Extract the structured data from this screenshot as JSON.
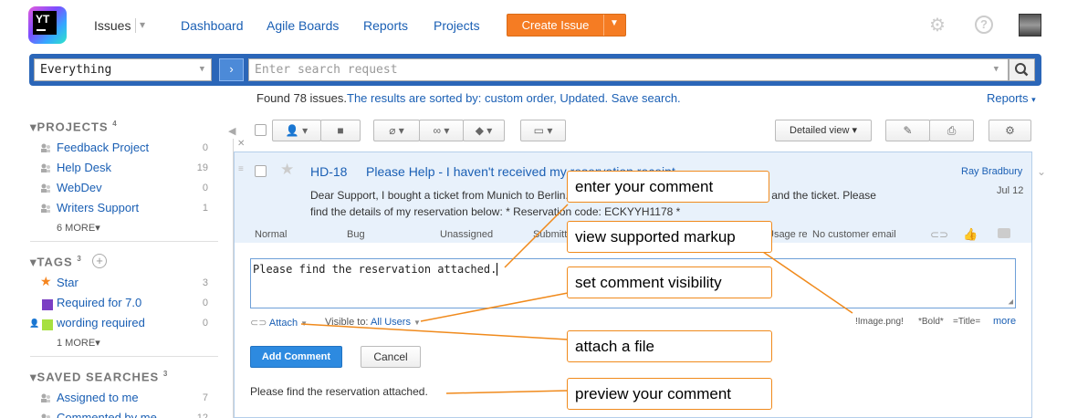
{
  "nav": {
    "logo_text": "YT",
    "issues": "Issues",
    "links": [
      "Dashboard",
      "Agile Boards",
      "Reports",
      "Projects"
    ],
    "create_issue": "Create Issue"
  },
  "search": {
    "context": "Everything",
    "placeholder": "Enter search request"
  },
  "results": {
    "found": "Found 78 issues.",
    "sorted_prefix": "The results are sorted by: ",
    "sort_link": "custom order, Updated.",
    "save_search": "Save search.",
    "reports": "Reports"
  },
  "sidebar": {
    "projects_title": "PROJECTS",
    "projects_count": "4",
    "projects": [
      {
        "name": "Feedback Project",
        "count": "0"
      },
      {
        "name": "Help Desk",
        "count": "19"
      },
      {
        "name": "WebDev",
        "count": "0"
      },
      {
        "name": "Writers Support",
        "count": "1"
      }
    ],
    "projects_more": "6 MORE",
    "tags_title": "TAGS",
    "tags_count": "3",
    "tags": [
      {
        "name": "Star",
        "count": "3",
        "color": "#f5851f"
      },
      {
        "name": "Required for 7.0",
        "count": "0",
        "color": "#7b3fc4"
      },
      {
        "name": "wording required",
        "count": "0",
        "color": "#a7e040"
      }
    ],
    "tags_more": "1 MORE",
    "saved_title": "SAVED SEARCHES",
    "saved_count": "3",
    "saved": [
      {
        "name": "Assigned to me",
        "count": "7"
      },
      {
        "name": "Commented by me",
        "count": "12"
      }
    ]
  },
  "toolbar": {
    "view": "Detailed view"
  },
  "issue": {
    "id": "HD-18",
    "summary": "Please Help - I haven't received my reservation receipt",
    "author": "Ray Bradbury",
    "date": "Jul 12",
    "desc_line1": "Dear Support, I bought a ticket from Munich to Berlin. I haven't received the reservation receipt and the ticket. Please",
    "desc_line2": "find the details of my reservation below: * Reservation code: ECKYYH1178 *",
    "fields": [
      "Normal",
      "Bug",
      "Unassigned",
      "Submitted",
      "Usage re",
      "No customer email"
    ]
  },
  "comment": {
    "text": "Please find the reservation attached.",
    "attach": "Attach",
    "visible_label": "Visible to:",
    "visible_value": "All Users",
    "markup": [
      "!Image.png!",
      "*Bold*",
      "=Title=",
      "more"
    ],
    "add": "Add Comment",
    "cancel": "Cancel",
    "preview": "Please find the reservation attached."
  },
  "callouts": {
    "enter": "enter your comment",
    "markup": "view supported markup",
    "visibility": "set comment visibility",
    "attach": "attach a file",
    "preview": "preview your comment"
  },
  "colors": {
    "accent": "#f57c23",
    "link": "#1a5fb4",
    "searchbar": "#2b66b8",
    "callout_border": "#f08a1c"
  }
}
